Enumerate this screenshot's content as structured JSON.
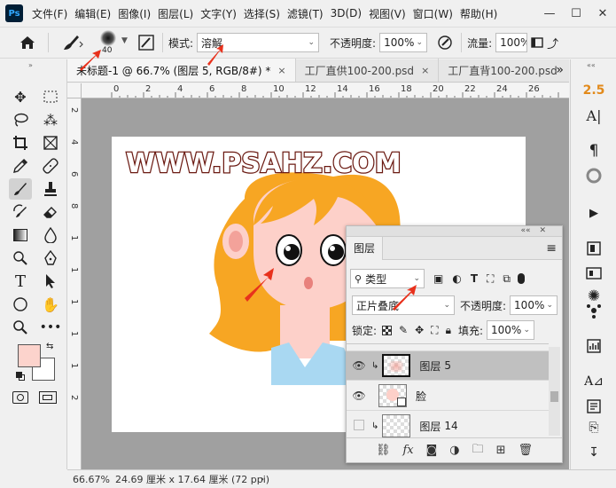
{
  "app": {
    "logo": "Ps"
  },
  "menu": [
    "文件(F)",
    "编辑(E)",
    "图像(I)",
    "图层(L)",
    "文字(Y)",
    "选择(S)",
    "滤镜(T)",
    "3D(D)",
    "视图(V)",
    "窗口(W)",
    "帮助(H)"
  ],
  "window_controls": {
    "minimize": "—",
    "restore": "☐",
    "close": "✕"
  },
  "options": {
    "home_icon": "home-icon",
    "brush_size": "40",
    "mode_label": "模式:",
    "mode_value": "溶解",
    "opacity_label": "不透明度:",
    "opacity_value": "100%",
    "flow_label": "流量:",
    "flow_value": "100%"
  },
  "tabs": [
    {
      "label": "未标题-1 @ 66.7% (图层 5, RGB/8#) *",
      "close": "×"
    },
    {
      "label": "工厂直供100-200.psd",
      "close": "×"
    },
    {
      "label": "工厂直背100-200.psd",
      "close": ""
    }
  ],
  "tabs_overflow": "»",
  "ruler": {
    "h": [
      "0",
      "2",
      "4",
      "6",
      "8",
      "10",
      "12",
      "14",
      "16",
      "18",
      "20",
      "22",
      "24",
      "26"
    ],
    "v": [
      "2",
      "4",
      "6",
      "8",
      "1",
      "1",
      "1",
      "1",
      "1",
      "2"
    ]
  },
  "canvas": {
    "watermark": "WWW.PSAHZ.COM",
    "colors": {
      "hair": "#f7a623",
      "skin": "#fdd0c9",
      "shirt": "#a9d8f2",
      "arrow": "#e8311c",
      "watermark_fill": "#ffffff",
      "watermark_stroke": "#6b1a12"
    }
  },
  "status": {
    "zoom": "66.67%",
    "doc_size": "24.69 厘米 x 17.64 厘米 (72 ppi)"
  },
  "right_panel": {
    "top_value": "2.5"
  },
  "layers_panel": {
    "title": "图层",
    "collapse": "««",
    "close": "✕",
    "menu": "≡",
    "filter_label": "类型",
    "blend_mode": "正片叠底",
    "opacity_label": "不透明度:",
    "opacity_value": "100%",
    "lock_label": "锁定:",
    "fill_label": "填充:",
    "fill_value": "100%",
    "layers": [
      {
        "name": "图层",
        "num": "5",
        "selected": true,
        "visible": true,
        "clipped": true
      },
      {
        "name": "脸",
        "num": "",
        "selected": false,
        "visible": true,
        "clipped": false
      },
      {
        "name": "图层",
        "num": "14",
        "selected": false,
        "visible": false,
        "clipped": true
      }
    ],
    "bottom_icons": [
      "link-icon",
      "fx-icon",
      "mask-icon",
      "adjustment-icon",
      "folder-icon",
      "new-layer-icon",
      "delete-icon"
    ]
  }
}
